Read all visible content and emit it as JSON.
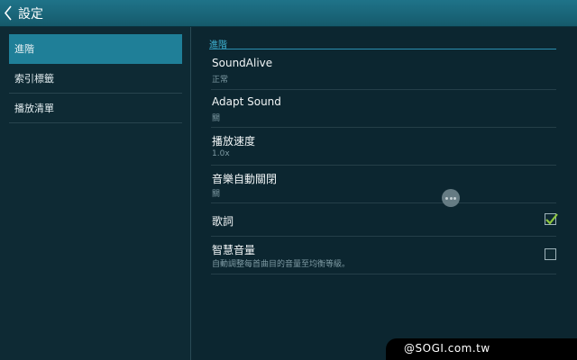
{
  "header": {
    "title": "設定"
  },
  "sidebar": {
    "items": [
      {
        "label": "進階",
        "active": true
      },
      {
        "label": "索引標籤",
        "active": false
      },
      {
        "label": "播放清單",
        "active": false
      }
    ]
  },
  "main": {
    "section_title": "進階",
    "settings": [
      {
        "name": "soundalive",
        "label": "SoundAlive",
        "sub": "正常"
      },
      {
        "name": "adapt-sound",
        "label": "Adapt Sound",
        "sub": "關"
      },
      {
        "name": "playback-speed",
        "label": "播放速度",
        "sub": "1.0x"
      },
      {
        "name": "music-auto-off",
        "label": "音樂自動關閉",
        "sub": "關"
      },
      {
        "name": "lyrics",
        "label": "歌詞",
        "checked": true
      },
      {
        "name": "smart-volume",
        "label": "智慧音量",
        "sub": "自動調整每首曲目的音量至均衡等級。",
        "checked": false
      }
    ]
  },
  "watermark": {
    "text": "@SOGI.com.tw"
  },
  "colors": {
    "accent": "#1f7f98",
    "check": "#8dc63f",
    "background": "#0c2630"
  }
}
